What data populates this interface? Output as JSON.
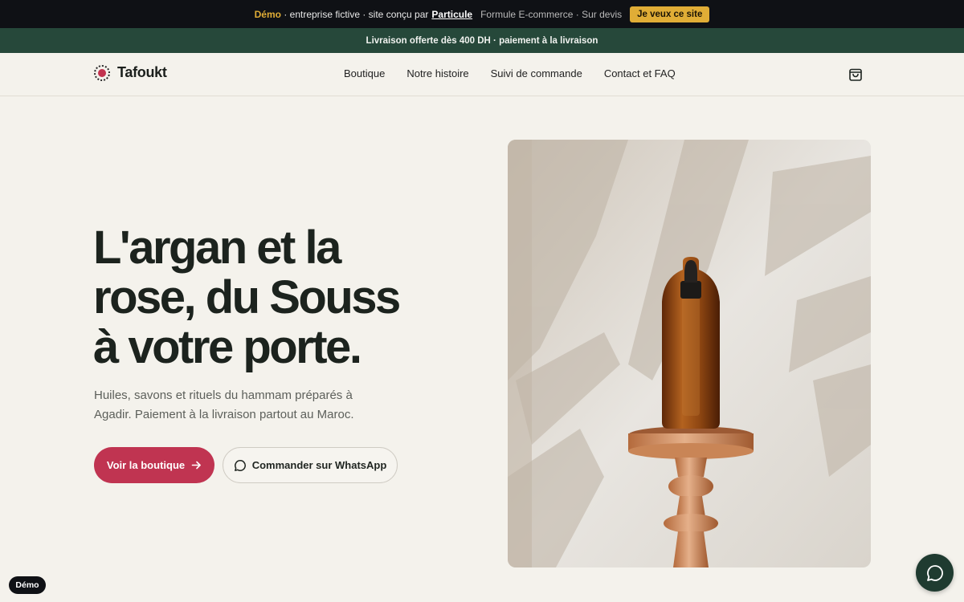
{
  "demo_bar": {
    "lead": "Démo",
    "text": " · entreprise fictive · site conçu par",
    "link": "Particule",
    "formula": "Formule E-commerce · Sur devis",
    "cta": "Je veux ce site"
  },
  "shipping_bar": {
    "text": "Livraison offerte dès 400 DH · paiement à la livraison"
  },
  "header": {
    "brand": "Tafoukt",
    "nav": [
      "Boutique",
      "Notre histoire",
      "Suivi de commande",
      "Contact et FAQ"
    ],
    "cart_icon": "shopping-bag-icon"
  },
  "hero": {
    "title_lines": [
      "L'argan et la",
      "rose, du Souss",
      "à votre porte."
    ],
    "subtitle_lines": [
      "Huiles, savons et rituels du hammam préparés à",
      "Agadir. Paiement à la livraison partout au Maroc."
    ],
    "primary_button": "Voir la boutique",
    "secondary_button": "Commander sur WhatsApp"
  },
  "floating": {
    "demo_badge": "Démo",
    "chat_icon": "chat-bubble-icon"
  },
  "colors": {
    "accent": "#c03451",
    "dark_green": "#26483a",
    "gold": "#e0ad36",
    "background": "#f4f2ec"
  }
}
